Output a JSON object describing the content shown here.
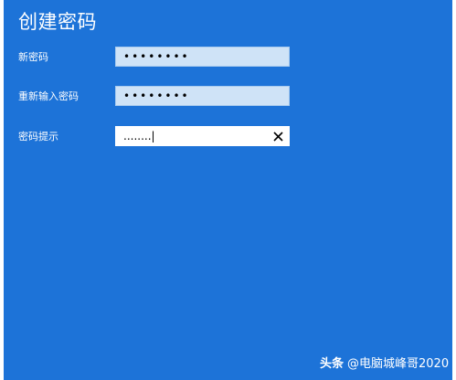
{
  "dialog": {
    "title": "创建密码",
    "new_password": {
      "label": "新密码",
      "value": "••••••••"
    },
    "confirm_password": {
      "label": "重新输入密码",
      "value": "••••••••"
    },
    "password_hint": {
      "label": "密码提示",
      "value": "........|",
      "clear_icon": "close-icon"
    }
  },
  "watermark": {
    "brand": "头条",
    "handle": "@电脑城峰哥2020"
  },
  "colors": {
    "background": "#1d73d8",
    "field_filled": "#cfe3f7",
    "field_active": "#ffffff",
    "text": "#ffffff"
  }
}
